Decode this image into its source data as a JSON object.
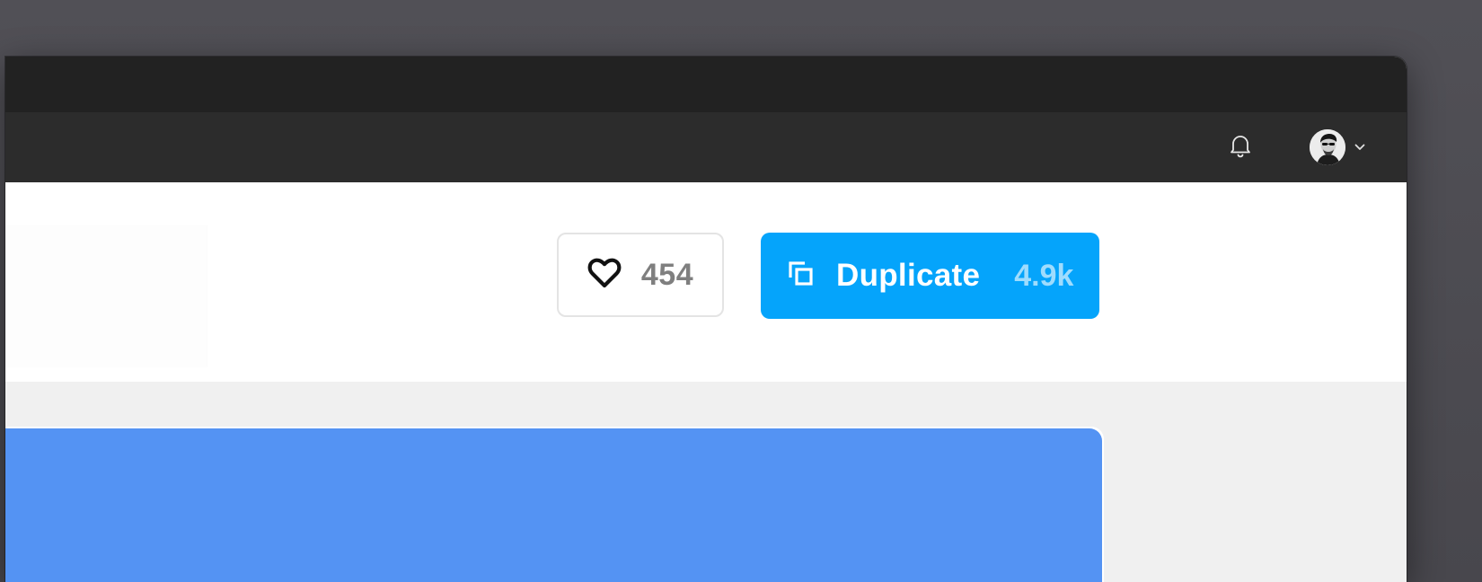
{
  "topbar": {
    "notifications_icon": "bell-icon",
    "account_menu_icon": "chevron-down-icon"
  },
  "header": {
    "like": {
      "icon": "heart-icon",
      "count": "454"
    },
    "duplicate": {
      "icon": "duplicate-icon",
      "label": "Duplicate",
      "count": "4.9k"
    }
  },
  "colors": {
    "accent": "#05a4fb",
    "preview": "#5493f3",
    "nav": "#2c2c2c",
    "titlebar": "#222222"
  }
}
